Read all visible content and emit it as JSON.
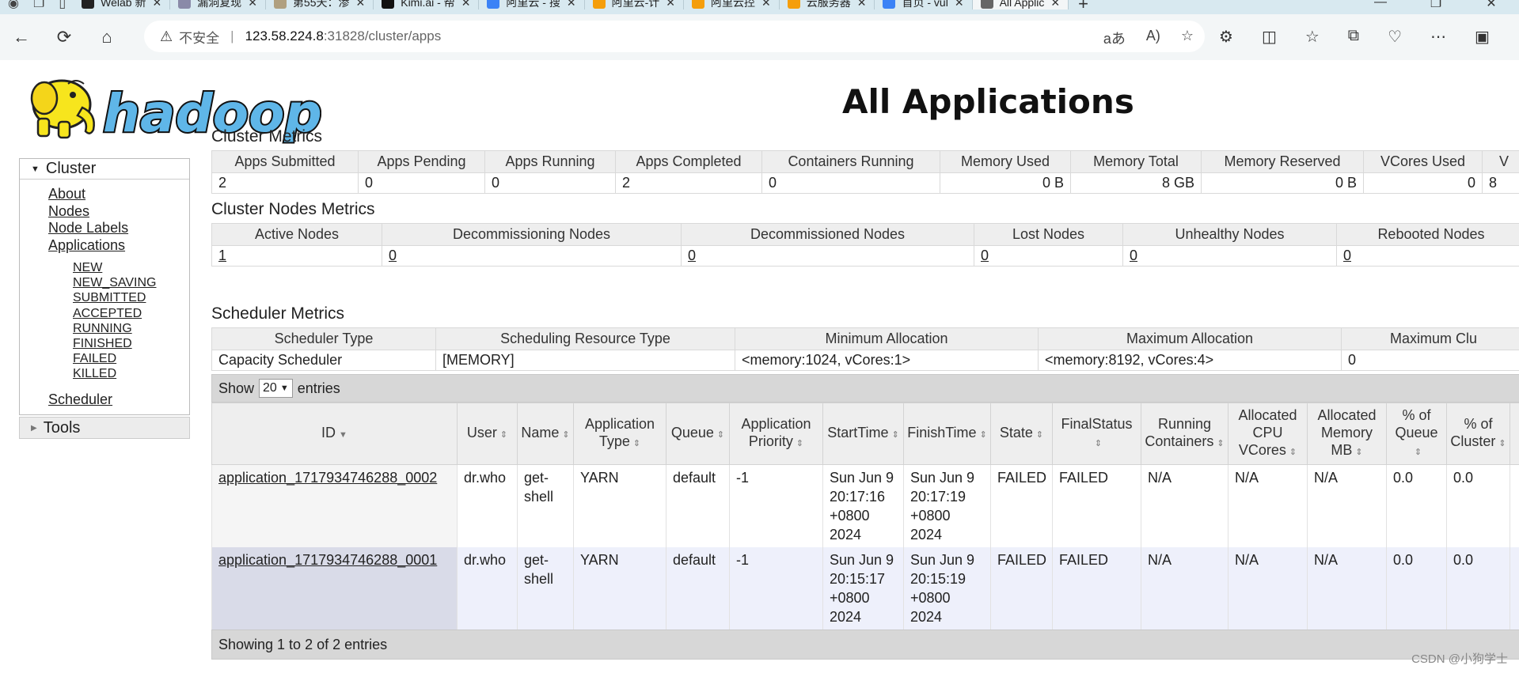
{
  "browser": {
    "tabs": [
      {
        "title": "Welab 新",
        "color": "#222"
      },
      {
        "title": "漏洞复现",
        "color": "#8a8aa8"
      },
      {
        "title": "第55天：渗",
        "color": "#b0a080"
      },
      {
        "title": "Kimi.ai - 帮",
        "color": "#111"
      },
      {
        "title": "阿里云 - 搜",
        "color": "#3b82f6"
      },
      {
        "title": "阿里云-计",
        "color": "#f59e0b"
      },
      {
        "title": "阿里云控",
        "color": "#f59e0b"
      },
      {
        "title": "云服务器",
        "color": "#f59e0b"
      },
      {
        "title": "首页 - vul",
        "color": "#3b82f6"
      },
      {
        "title": "All Applic",
        "color": "#666",
        "active": true
      }
    ],
    "address": {
      "insecure_label": "不安全",
      "host": "123.58.224.8",
      "path": ":31828/cluster/apps"
    }
  },
  "page": {
    "title": "All Applications",
    "logo_text": "hadoop"
  },
  "sidebar": {
    "cluster_label": "Cluster",
    "links": [
      "About",
      "Nodes",
      "Node Labels",
      "Applications"
    ],
    "states": [
      "NEW",
      "NEW_SAVING",
      "SUBMITTED",
      "ACCEPTED",
      "RUNNING",
      "FINISHED",
      "FAILED",
      "KILLED"
    ],
    "scheduler_label": "Scheduler",
    "tools_label": "Tools"
  },
  "cluster_metrics": {
    "title": "Cluster Metrics",
    "headers": [
      "Apps Submitted",
      "Apps Pending",
      "Apps Running",
      "Apps Completed",
      "Containers Running",
      "Memory Used",
      "Memory Total",
      "Memory Reserved",
      "VCores Used",
      "V"
    ],
    "values": [
      "2",
      "0",
      "0",
      "2",
      "0",
      "0 B",
      "8 GB",
      "0 B",
      "0",
      "8"
    ]
  },
  "nodes_metrics": {
    "title": "Cluster Nodes Metrics",
    "headers": [
      "Active Nodes",
      "Decommissioning Nodes",
      "Decommissioned Nodes",
      "Lost Nodes",
      "Unhealthy Nodes",
      "Rebooted Nodes"
    ],
    "values": [
      "1",
      "0",
      "0",
      "0",
      "0",
      "0"
    ]
  },
  "scheduler_metrics": {
    "title": "Scheduler Metrics",
    "headers": [
      "Scheduler Type",
      "Scheduling Resource Type",
      "Minimum Allocation",
      "Maximum Allocation",
      "Maximum Clu"
    ],
    "values": [
      "Capacity Scheduler",
      "[MEMORY]",
      "<memory:1024, vCores:1>",
      "<memory:8192, vCores:4>",
      "0"
    ]
  },
  "apps_table": {
    "show_label": "Show",
    "page_size": "20",
    "entries_label": "entries",
    "headers": [
      "ID",
      "User",
      "Name",
      "Application Type",
      "Queue",
      "Application Priority",
      "StartTime",
      "FinishTime",
      "State",
      "FinalStatus",
      "Running Containers",
      "Allocated CPU VCores",
      "Allocated Memory MB",
      "% of Queue",
      "% of Cluster"
    ],
    "rows": [
      {
        "id": "application_1717934746288_0002",
        "user": "dr.who",
        "name": "get-shell",
        "type": "YARN",
        "queue": "default",
        "priority": "-1",
        "start": "Sun Jun 9 20:17:16 +0800 2024",
        "finish": "Sun Jun 9 20:17:19 +0800 2024",
        "state": "FAILED",
        "final": "FAILED",
        "containers": "N/A",
        "vcores": "N/A",
        "memory": "N/A",
        "pct_queue": "0.0",
        "pct_cluster": "0.0"
      },
      {
        "id": "application_1717934746288_0001",
        "user": "dr.who",
        "name": "get-shell",
        "type": "YARN",
        "queue": "default",
        "priority": "-1",
        "start": "Sun Jun 9 20:15:17 +0800 2024",
        "finish": "Sun Jun 9 20:15:19 +0800 2024",
        "state": "FAILED",
        "final": "FAILED",
        "containers": "N/A",
        "vcores": "N/A",
        "memory": "N/A",
        "pct_queue": "0.0",
        "pct_cluster": "0.0"
      }
    ],
    "footer": "Showing 1 to 2 of 2 entries"
  },
  "watermark": "CSDN @小狗学士"
}
